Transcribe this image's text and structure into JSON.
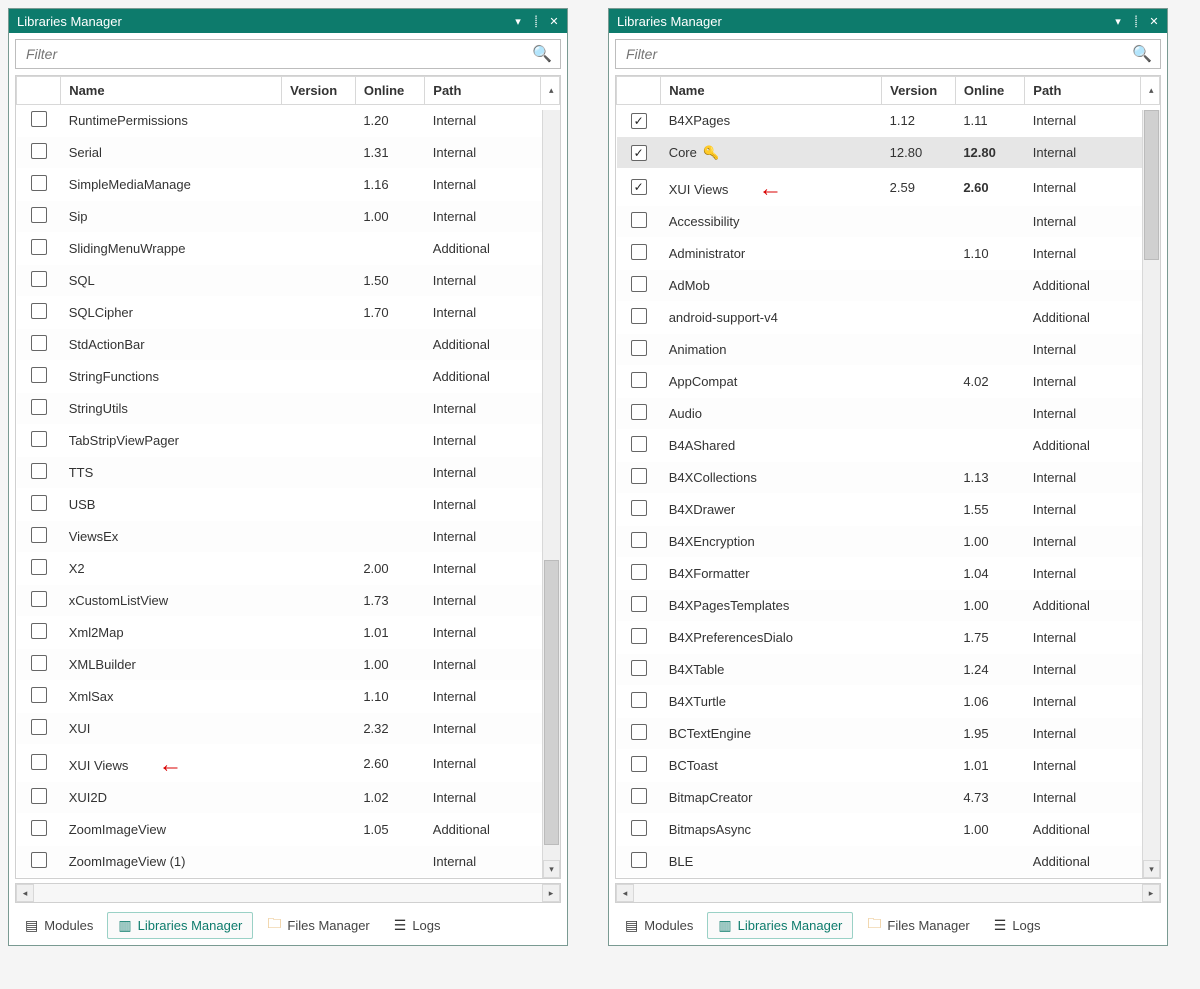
{
  "filter_placeholder": "Filter",
  "headers": {
    "name": "Name",
    "version": "Version",
    "online": "Online",
    "path": "Path"
  },
  "tabs": {
    "modules": "Modules",
    "libs": "Libraries Manager",
    "files": "Files Manager",
    "logs": "Logs"
  },
  "left": {
    "title": "Libraries Manager",
    "arrow_row_index": 17,
    "rows": [
      {
        "name": "RuntimePermissions",
        "version": "",
        "online": "1.20",
        "path": "Internal",
        "checked": false
      },
      {
        "name": "Serial",
        "version": "",
        "online": "1.31",
        "path": "Internal",
        "checked": false
      },
      {
        "name": "SimpleMediaManage",
        "version": "",
        "online": "1.16",
        "path": "Internal",
        "checked": false
      },
      {
        "name": "Sip",
        "version": "",
        "online": "1.00",
        "path": "Internal",
        "checked": false
      },
      {
        "name": "SlidingMenuWrappe",
        "version": "",
        "online": "",
        "path": "Additional",
        "checked": false
      },
      {
        "name": "SQL",
        "version": "",
        "online": "1.50",
        "path": "Internal",
        "checked": false
      },
      {
        "name": "SQLCipher",
        "version": "",
        "online": "1.70",
        "path": "Internal",
        "checked": false
      },
      {
        "name": "StdActionBar",
        "version": "",
        "online": "",
        "path": "Additional",
        "checked": false
      },
      {
        "name": "StringFunctions",
        "version": "",
        "online": "",
        "path": "Additional",
        "checked": false
      },
      {
        "name": "StringUtils",
        "version": "",
        "online": "",
        "path": "Internal",
        "checked": false
      },
      {
        "name": "TabStripViewPager",
        "version": "",
        "online": "",
        "path": "Internal",
        "checked": false
      },
      {
        "name": "TTS",
        "version": "",
        "online": "",
        "path": "Internal",
        "checked": false
      },
      {
        "name": "USB",
        "version": "",
        "online": "",
        "path": "Internal",
        "checked": false
      },
      {
        "name": "ViewsEx",
        "version": "",
        "online": "",
        "path": "Internal",
        "checked": false
      },
      {
        "name": "X2",
        "version": "",
        "online": "2.00",
        "path": "Internal",
        "checked": false
      },
      {
        "name": "xCustomListView",
        "version": "",
        "online": "1.73",
        "path": "Internal",
        "checked": false
      },
      {
        "name": "Xml2Map",
        "version": "",
        "online": "1.01",
        "path": "Internal",
        "checked": false
      },
      {
        "name": "XMLBuilder",
        "version": "",
        "online": "1.00",
        "path": "Internal",
        "checked": false
      },
      {
        "name": "XmlSax",
        "version": "",
        "online": "1.10",
        "path": "Internal",
        "checked": false
      },
      {
        "name": "XUI",
        "version": "",
        "online": "2.32",
        "path": "Internal",
        "checked": false
      },
      {
        "name": "XUI Views",
        "version": "",
        "online": "2.60",
        "path": "Internal",
        "checked": false,
        "arrow": true
      },
      {
        "name": "XUI2D",
        "version": "",
        "online": "1.02",
        "path": "Internal",
        "checked": false
      },
      {
        "name": "ZoomImageView",
        "version": "",
        "online": "1.05",
        "path": "Additional",
        "checked": false
      },
      {
        "name": "ZoomImageView (1)",
        "version": "",
        "online": "",
        "path": "Internal",
        "checked": false
      }
    ],
    "scroll_thumb": {
      "top_pct": 60,
      "height_pct": 38
    }
  },
  "right": {
    "title": "Libraries Manager",
    "selected_index": 1,
    "rows": [
      {
        "name": "B4XPages",
        "version": "1.12",
        "online": "1.11",
        "path": "Internal",
        "checked": true
      },
      {
        "name": "Core",
        "version": "12.80",
        "online": "12.80",
        "path": "Internal",
        "checked": true,
        "key": true,
        "online_bold": true,
        "selected": true
      },
      {
        "name": "XUI Views",
        "version": "2.59",
        "online": "2.60",
        "path": "Internal",
        "checked": true,
        "online_bold": true,
        "arrow": true
      },
      {
        "name": "Accessibility",
        "version": "",
        "online": "",
        "path": "Internal",
        "checked": false
      },
      {
        "name": "Administrator",
        "version": "",
        "online": "1.10",
        "path": "Internal",
        "checked": false
      },
      {
        "name": "AdMob",
        "version": "",
        "online": "",
        "path": "Additional",
        "checked": false
      },
      {
        "name": "android-support-v4",
        "version": "",
        "online": "",
        "path": "Additional",
        "checked": false
      },
      {
        "name": "Animation",
        "version": "",
        "online": "",
        "path": "Internal",
        "checked": false
      },
      {
        "name": "AppCompat",
        "version": "",
        "online": "4.02",
        "path": "Internal",
        "checked": false
      },
      {
        "name": "Audio",
        "version": "",
        "online": "",
        "path": "Internal",
        "checked": false
      },
      {
        "name": "B4AShared",
        "version": "",
        "online": "",
        "path": "Additional",
        "checked": false
      },
      {
        "name": "B4XCollections",
        "version": "",
        "online": "1.13",
        "path": "Internal",
        "checked": false
      },
      {
        "name": "B4XDrawer",
        "version": "",
        "online": "1.55",
        "path": "Internal",
        "checked": false
      },
      {
        "name": "B4XEncryption",
        "version": "",
        "online": "1.00",
        "path": "Internal",
        "checked": false
      },
      {
        "name": "B4XFormatter",
        "version": "",
        "online": "1.04",
        "path": "Internal",
        "checked": false
      },
      {
        "name": "B4XPagesTemplates",
        "version": "",
        "online": "1.00",
        "path": "Additional",
        "checked": false
      },
      {
        "name": "B4XPreferencesDialo",
        "version": "",
        "online": "1.75",
        "path": "Internal",
        "checked": false
      },
      {
        "name": "B4XTable",
        "version": "",
        "online": "1.24",
        "path": "Internal",
        "checked": false
      },
      {
        "name": "B4XTurtle",
        "version": "",
        "online": "1.06",
        "path": "Internal",
        "checked": false
      },
      {
        "name": "BCTextEngine",
        "version": "",
        "online": "1.95",
        "path": "Internal",
        "checked": false
      },
      {
        "name": "BCToast",
        "version": "",
        "online": "1.01",
        "path": "Internal",
        "checked": false
      },
      {
        "name": "BitmapCreator",
        "version": "",
        "online": "4.73",
        "path": "Internal",
        "checked": false
      },
      {
        "name": "BitmapsAsync",
        "version": "",
        "online": "1.00",
        "path": "Additional",
        "checked": false
      },
      {
        "name": "BLE",
        "version": "",
        "online": "",
        "path": "Additional",
        "checked": false
      }
    ],
    "scroll_thumb": {
      "top_pct": 0,
      "height_pct": 20
    }
  }
}
